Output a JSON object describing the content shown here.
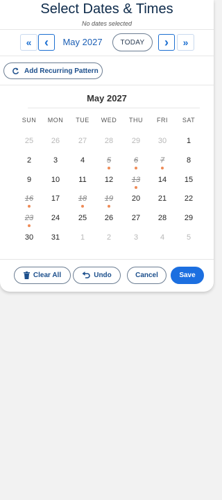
{
  "header": {
    "title": "Select Dates & Times",
    "subtitle": "No dates selected"
  },
  "nav": {
    "prev_year_icon": "«",
    "prev_month_icon": "‹",
    "month_label": "May 2027",
    "today_label": "TODAY",
    "next_month_icon": "›",
    "next_year_icon": "»"
  },
  "recurring": {
    "label": "Add Recurring Pattern",
    "icon": "refresh-icon"
  },
  "calendar": {
    "title": "May 2027",
    "weekdays": [
      "SUN",
      "MON",
      "TUE",
      "WED",
      "THU",
      "FRI",
      "SAT"
    ],
    "weeks": [
      [
        {
          "n": "25",
          "s": "other"
        },
        {
          "n": "26",
          "s": "other"
        },
        {
          "n": "27",
          "s": "other"
        },
        {
          "n": "28",
          "s": "other"
        },
        {
          "n": "29",
          "s": "other"
        },
        {
          "n": "30",
          "s": "other"
        },
        {
          "n": "1",
          "s": "normal"
        }
      ],
      [
        {
          "n": "2",
          "s": "normal"
        },
        {
          "n": "3",
          "s": "normal"
        },
        {
          "n": "4",
          "s": "normal"
        },
        {
          "n": "5",
          "s": "past",
          "dot": true
        },
        {
          "n": "6",
          "s": "past",
          "dot": true
        },
        {
          "n": "7",
          "s": "past",
          "dot": true
        },
        {
          "n": "8",
          "s": "normal"
        }
      ],
      [
        {
          "n": "9",
          "s": "normal"
        },
        {
          "n": "10",
          "s": "normal"
        },
        {
          "n": "11",
          "s": "normal"
        },
        {
          "n": "12",
          "s": "normal"
        },
        {
          "n": "13",
          "s": "past",
          "dot": true
        },
        {
          "n": "14",
          "s": "normal"
        },
        {
          "n": "15",
          "s": "normal"
        }
      ],
      [
        {
          "n": "16",
          "s": "past",
          "dot": true
        },
        {
          "n": "17",
          "s": "normal"
        },
        {
          "n": "18",
          "s": "past",
          "dot": true
        },
        {
          "n": "19",
          "s": "past",
          "dot": true
        },
        {
          "n": "20",
          "s": "normal"
        },
        {
          "n": "21",
          "s": "normal"
        },
        {
          "n": "22",
          "s": "normal"
        }
      ],
      [
        {
          "n": "23",
          "s": "past",
          "dot": true
        },
        {
          "n": "24",
          "s": "normal"
        },
        {
          "n": "25",
          "s": "normal"
        },
        {
          "n": "26",
          "s": "normal"
        },
        {
          "n": "27",
          "s": "normal"
        },
        {
          "n": "28",
          "s": "normal"
        },
        {
          "n": "29",
          "s": "normal"
        }
      ],
      [
        {
          "n": "30",
          "s": "normal"
        },
        {
          "n": "31",
          "s": "normal"
        },
        {
          "n": "1",
          "s": "other"
        },
        {
          "n": "2",
          "s": "other"
        },
        {
          "n": "3",
          "s": "other"
        },
        {
          "n": "4",
          "s": "other"
        },
        {
          "n": "5",
          "s": "other"
        }
      ]
    ]
  },
  "actions": {
    "clear_all": "Clear All",
    "undo": "Undo",
    "cancel": "Cancel",
    "save": "Save"
  },
  "colors": {
    "accent": "#1c6fe0",
    "event_dot": "#ef8b57",
    "title": "#0d2a4a"
  }
}
